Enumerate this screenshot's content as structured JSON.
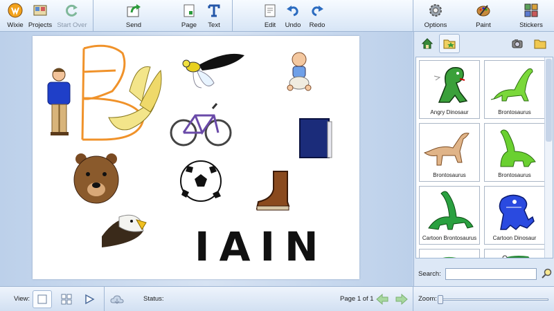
{
  "toolbar": {
    "buttons": [
      {
        "label": "Wixie",
        "icon": "wixie-logo-icon"
      },
      {
        "label": "Projects",
        "icon": "projects-icon"
      },
      {
        "label": "Start Over",
        "icon": "start-over-icon",
        "disabled": true
      },
      {
        "label": "Send",
        "icon": "send-icon"
      },
      {
        "label": "Page",
        "icon": "page-icon"
      },
      {
        "label": "Text",
        "icon": "text-icon"
      },
      {
        "label": "Edit",
        "icon": "edit-icon"
      },
      {
        "label": "Undo",
        "icon": "undo-icon"
      },
      {
        "label": "Redo",
        "icon": "redo-icon"
      },
      {
        "label": "Options",
        "icon": "options-gear-icon"
      },
      {
        "label": "Paint",
        "icon": "paint-palette-icon"
      },
      {
        "label": "Stickers",
        "icon": "stickers-icon"
      }
    ]
  },
  "canvas": {
    "word": "IAIN",
    "stickers": [
      "man-sticker",
      "letter-b-drawing",
      "banana-sticker",
      "dragonfly-sticker",
      "baby-sticker",
      "bicycle-sticker",
      "book-sticker",
      "bear-sticker",
      "soccer-ball-sticker",
      "boot-sticker",
      "eagle-sticker"
    ]
  },
  "panel": {
    "tabs": [
      "home-tab-icon",
      "folder-star-tab-icon",
      "camera-tab-icon",
      "folder-tab-icon"
    ],
    "gallery": [
      {
        "caption": "Angry Dinosaur"
      },
      {
        "caption": "Brontosaurus"
      },
      {
        "caption": "Brontosaurus"
      },
      {
        "caption": "Brontosaurus"
      },
      {
        "caption": "Cartoon Brontosaurus"
      },
      {
        "caption": "Cartoon Dinosaur"
      }
    ],
    "search": {
      "label": "Search:",
      "value": ""
    }
  },
  "bottom": {
    "view_label": "View:",
    "status_label": "Status:",
    "status_value": "",
    "page_indicator": "Page 1 of 1",
    "zoom_label": "Zoom:",
    "zoom_level": 0.0
  },
  "colors": {
    "accent": "#2f6fc0",
    "panel_bg": "#dde8f6",
    "toolbar_bg": "#d7e5f6"
  }
}
